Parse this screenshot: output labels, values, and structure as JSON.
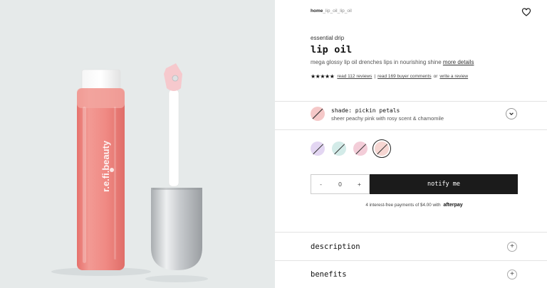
{
  "breadcrumb": {
    "home": "home",
    "separator": "_",
    "current": "lip_oil_lip_oil"
  },
  "icons": {
    "wishlist": "heart-icon",
    "expand": "chevron-down-icon",
    "accordion": "plus-icon",
    "rating": "star-icon"
  },
  "product": {
    "brand_text": "r.e.fi.beauty",
    "collection": "essential drip",
    "title": "lip oil",
    "description": "mega glossy lip oil drenches lips in nourishing shine",
    "more_details": "more details"
  },
  "rating": {
    "value": 4.5,
    "stars": "★★★★★",
    "reviews_link": "read 112 reviews",
    "separator": "|",
    "comments_link": "read 169 buyer comments",
    "or_text": "or",
    "write_link": "write a review"
  },
  "shade": {
    "label": "shade: pickin petals",
    "description": "sheer peachy pink with rosy scent & chamomile",
    "color": "#f5c8c8"
  },
  "swatches": [
    {
      "color": "#e3d6f2",
      "selected": false
    },
    {
      "color": "#d3ebe8",
      "selected": false
    },
    {
      "color": "#f3cdd8",
      "selected": false
    },
    {
      "color": "#f6d6d2",
      "selected": true
    }
  ],
  "quantity": {
    "minus": "-",
    "value": "0",
    "plus": "+"
  },
  "notify_button": "notify me",
  "afterpay": {
    "text": "4 interest-free payments of $4.00 with",
    "logo": "afterpay"
  },
  "accordions": [
    {
      "label": "description",
      "icon": "+"
    },
    {
      "label": "benefits",
      "icon": "+"
    }
  ],
  "colors": {
    "accent": "#1b1b1b",
    "tube": "#f08b86",
    "background": "#e6eaea"
  }
}
